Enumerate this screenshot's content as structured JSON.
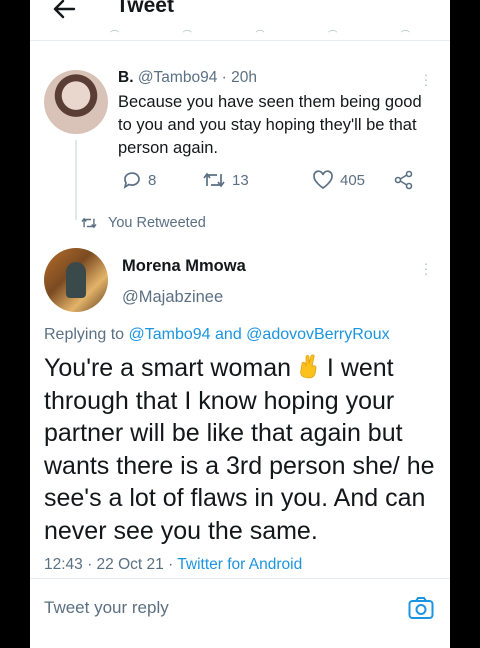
{
  "header": {
    "title": "Tweet"
  },
  "previous_tweet": {
    "name": "B.",
    "handle": "@Tambo94",
    "separator": "·",
    "age": "20h",
    "text": "Because you have seen them being good to you and you stay hoping they'll be that person again.",
    "replies": "8",
    "retweets": "13",
    "likes": "405"
  },
  "retweet_notice": "You Retweeted",
  "main_tweet": {
    "name": "Morena Mmowa",
    "handle": "@Majabzinee",
    "replying_prefix": "Replying to",
    "reply_to_1": "@Tambo94",
    "reply_and": "and",
    "reply_to_2": "@adovovBerryRoux",
    "text_before_emoji": "You're a smart woman",
    "text_after_emoji": " I went through that I know hoping your partner will be like that again but wants there is a 3rd person she/ he see's a lot of flaws in you. And can never see you the same.",
    "time": "12:43 · 22 Oct 21 ·",
    "source": "Twitter for Android"
  },
  "reply_bar": {
    "placeholder": "Tweet your reply"
  },
  "colors": {
    "link": "#1b95e0",
    "muted": "#5b7083",
    "text": "#14171a"
  }
}
